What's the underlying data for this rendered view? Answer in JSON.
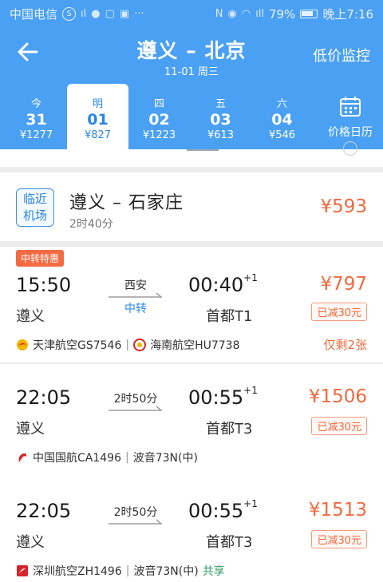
{
  "status_bar": {
    "carrier": "中国电信",
    "battery": "79%",
    "time": "晚上7:16"
  },
  "header": {
    "title": "遵义 – 北京",
    "subtitle": "11-01 周三",
    "monitor_label": "低价监控"
  },
  "date_tabs": [
    {
      "weekday": "今",
      "day": "31",
      "price": "¥1277"
    },
    {
      "weekday": "明",
      "day": "01",
      "price": "¥827"
    },
    {
      "weekday": "四",
      "day": "02",
      "price": "¥1223"
    },
    {
      "weekday": "五",
      "day": "03",
      "price": "¥613"
    },
    {
      "weekday": "六",
      "day": "04",
      "price": "¥546"
    }
  ],
  "calendar_label": "价格日历",
  "nearby_airport": {
    "badge_line1": "临近",
    "badge_line2": "机场",
    "route": "遵义 – 石家庄",
    "duration": "2时40分",
    "price": "¥593"
  },
  "flights": [
    {
      "promo": "中转特惠",
      "dep_time": "15:50",
      "arr_time": "00:40",
      "day_offset": "+1",
      "dep_airport": "遵义",
      "arr_airport": "首都T1",
      "mid_top": "西安",
      "mid_bottom": "中转",
      "price": "¥797",
      "discount": "已减30元",
      "airline1": "天津航空GS7546",
      "airline2": "海南航空HU7738",
      "seats": "仅剩2张"
    },
    {
      "dep_time": "22:05",
      "arr_time": "00:55",
      "day_offset": "+1",
      "dep_airport": "遵义",
      "arr_airport": "首都T3",
      "mid_top": "2时50分",
      "price": "¥1506",
      "discount": "已减30元",
      "airline1": "中国国航CA1496",
      "aircraft": "波音73N(中)"
    },
    {
      "dep_time": "22:05",
      "arr_time": "00:55",
      "day_offset": "+1",
      "dep_airport": "遵义",
      "arr_airport": "首都T3",
      "mid_top": "2时50分",
      "price": "¥1513",
      "discount": "已减30元",
      "airline1": "深圳航空ZH1496",
      "aircraft": "波音73N(中)",
      "shared": "共享"
    }
  ],
  "colors": {
    "header_bg": "#4aa0f2",
    "price": "#f06a3e",
    "accent": "#2b86e6"
  }
}
